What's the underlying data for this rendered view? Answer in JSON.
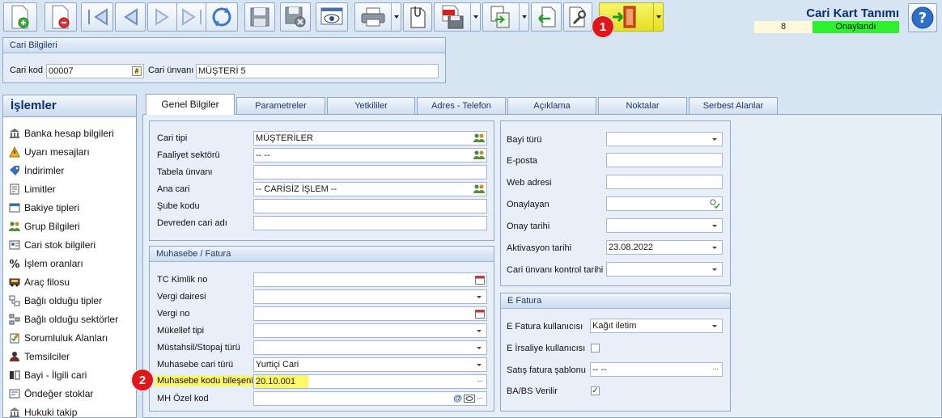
{
  "window": {
    "title": "Cari Kart Tanımı",
    "status_number": "8",
    "status_text": "Onaylandı"
  },
  "colors": {
    "status_ok": "#2ef02e",
    "highlight": "#fdf76a",
    "marker": "#e0161b",
    "title": "#0d2f6f"
  },
  "markers": {
    "one": "1",
    "two": "2"
  },
  "toolbar": {
    "icons": [
      "new-doc-icon",
      "delete-doc-icon",
      "first-record-icon",
      "previous-record-icon",
      "next-record-icon",
      "last-record-icon",
      "refresh-icon",
      "save-icon",
      "save-close-icon",
      "preview-icon",
      "print-icon",
      "copy-icon",
      "pdf-save-icon",
      "export-icon",
      "back-icon",
      "settings-wrench-icon",
      "exit-door-icon",
      "help-icon"
    ]
  },
  "cari_bilgileri": {
    "header": "Cari Bilgileri",
    "kod_label": "Cari kod",
    "kod_value": "00007",
    "kod_button": "#",
    "unvan_label": "Cari ünvanı",
    "unvan_value": "MÜŞTERİ 5"
  },
  "sidebar": {
    "title": "İşlemler",
    "items": [
      {
        "label": "Banka hesap bilgileri",
        "icon": "bank-icon"
      },
      {
        "label": "Uyarı mesajları",
        "icon": "warning-icon"
      },
      {
        "label": "İndirimler",
        "icon": "discount-tag-icon"
      },
      {
        "label": "Limitler",
        "icon": "limit-doc-icon"
      },
      {
        "label": "Bakiye tipleri",
        "icon": "balance-type-icon"
      },
      {
        "label": "Grup Bilgileri",
        "icon": "group-users-icon"
      },
      {
        "label": "Cari stok bilgileri",
        "icon": "stock-card-icon"
      },
      {
        "label": "İşlem oranları",
        "icon": "percent-icon"
      },
      {
        "label": "Araç filosu",
        "icon": "vehicle-icon"
      },
      {
        "label": "Bağlı olduğu tipler",
        "icon": "linked-types-icon"
      },
      {
        "label": "Bağlı olduğu sektörler",
        "icon": "linked-sectors-icon"
      },
      {
        "label": "Sorumluluk Alanları",
        "icon": "responsibility-icon"
      },
      {
        "label": "Temsilciler",
        "icon": "representative-icon"
      },
      {
        "label": "Bayi - İlgili cari",
        "icon": "dealer-icon"
      },
      {
        "label": "Öndeğer stoklar",
        "icon": "default-stock-icon"
      },
      {
        "label": "Hukuki takip",
        "icon": "legal-icon"
      }
    ]
  },
  "tabs": [
    {
      "label": "Genel Bilgiler"
    },
    {
      "label": "Parametreler"
    },
    {
      "label": "Yetkililer"
    },
    {
      "label": "Adres - Telefon"
    },
    {
      "label": "Açıklama"
    },
    {
      "label": "Noktalar"
    },
    {
      "label": "Serbest Alanlar"
    }
  ],
  "genel": {
    "cari_tipi_label": "Cari tipi",
    "cari_tipi_value": "MÜŞTERİLER",
    "faaliyet_label": "Faaliyet sektörü",
    "faaliyet_value": "-- --",
    "tabela_label": "Tabela ünvanı",
    "tabela_value": "",
    "ana_cari_label": "Ana cari",
    "ana_cari_value": "-- CARİSİZ İŞLEM --",
    "sube_label": "Şube kodu",
    "sube_value": "",
    "devreden_label": "Devreden cari adı",
    "devreden_value": ""
  },
  "muhasebe": {
    "header": "Muhasebe / Fatura",
    "tc_label": "TC Kimlik no",
    "vergi_dairesi_label": "Vergi dairesi",
    "vergi_no_label": "Vergi no",
    "mukellef_label": "Mükellef tipi",
    "mustahsil_label": "Müstahsil/Stopaj türü",
    "muh_cari_turu_label": "Muhasebe cari türü",
    "muh_cari_turu_value": "Yurtiçi Cari",
    "muh_kodu_label": "Muhasebe kodu bileşeni",
    "muh_kodu_value": "20.10.001",
    "mh_ozel_label": "MH Özel kod",
    "mh_ozel_value": "",
    "at_symbol": "@"
  },
  "right": {
    "bayi_label": "Bayi türü",
    "eposta_label": "E-posta",
    "web_label": "Web adresi",
    "onaylayan_label": "Onaylayan",
    "onay_tarihi_label": "Onay tarihi",
    "aktivasyon_label": "Aktivasyon tarihi",
    "aktivasyon_value": "23.08.2022",
    "unvan_kontrol_label": "Cari ünvanı kontrol tarihi"
  },
  "efatura": {
    "header": "E Fatura",
    "kullanici_label": "E Fatura kullanıcısı",
    "kullanici_value": "Kağıt iletim",
    "irsaliye_label": "E İrsaliye kullanıcısı",
    "irsaliye_checked": false,
    "sablon_label": "Satış fatura şablonu",
    "sablon_value": "-- --",
    "babs_label": "BA/BS Verilir",
    "babs_checked": true,
    "check_mark": "✓"
  },
  "misc": {
    "ellipsis": "···",
    "calendar_day": "31"
  }
}
